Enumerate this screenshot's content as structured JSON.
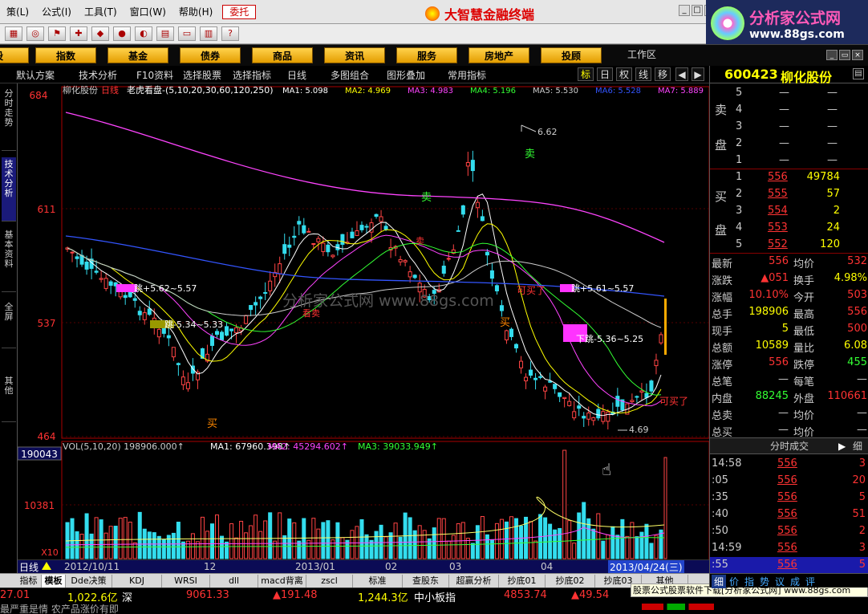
{
  "menubar": {
    "items": [
      "策(L)",
      "公式(I)",
      "工具(T)",
      "窗口(W)",
      "帮助(H)"
    ],
    "entrust": "委托",
    "app_title": "大智慧金融终端"
  },
  "brand": {
    "title": "分析家公式网",
    "url": "www.88gs.com"
  },
  "categories": [
    "股",
    "指数",
    "基金",
    "债券",
    "商品",
    "资讯",
    "服务",
    "房地产",
    "投顾"
  ],
  "workarea": "工作区",
  "chart_toolbar": {
    "items": [
      "默认方案",
      "技术分析",
      "F10资料",
      "选择股票",
      "选择指标",
      "日线",
      "多图组合",
      "图形叠加",
      "常用指标"
    ],
    "right": [
      "标",
      "日",
      "权",
      "线",
      "移"
    ]
  },
  "vtabs": [
    "分时走势",
    "技术分析",
    "基本资料",
    "全屏",
    "其他"
  ],
  "chart": {
    "stock": "柳化股份",
    "period": "日线",
    "indicator": "老虎看盘-(5,10,20,30,60,120,250)",
    "ma_legend": [
      {
        "name": "MA1: 5.098",
        "color": "#ffffff"
      },
      {
        "name": "MA2: 4.969",
        "color": "#ffff00"
      },
      {
        "name": "MA3: 4.983",
        "color": "#ff44ff"
      },
      {
        "name": "MA4: 5.196",
        "color": "#33ff33"
      },
      {
        "name": "MA5: 5.530",
        "color": "#cccccc"
      },
      {
        "name": "MA6: 5.528",
        "color": "#3355ff"
      },
      {
        "name": "MA7: 5.889",
        "color": "#ff44ff"
      }
    ],
    "price_ticks": [
      "684",
      "611",
      "537",
      "464"
    ],
    "annotations": [
      {
        "text": "6.62",
        "color": "#cccccc"
      },
      {
        "text": "卖",
        "color": "#33ff33"
      },
      {
        "text": "卖",
        "color": "#33ff33"
      },
      {
        "text": "买",
        "color": "#ff8800"
      },
      {
        "text": "买",
        "color": "#ff8800"
      },
      {
        "text": "可买了",
        "color": "#ff3333"
      },
      {
        "text": "可买了",
        "color": "#ff3333"
      },
      {
        "text": "看卖",
        "color": "#ff3333"
      },
      {
        "text": "卖",
        "color": "#ff3333"
      },
      {
        "text": "4.69",
        "color": "#cccccc"
      },
      {
        "text": "跳+5.62~5.57",
        "color": "#ffffff"
      },
      {
        "text": "跳-5.34~5.33",
        "color": "#ffffff"
      },
      {
        "text": "跳+5.61~5.57",
        "color": "#ffffff"
      },
      {
        "text": "下跳-5.36~5.25",
        "color": "#ffffff"
      }
    ],
    "watermark": "分析家公式网 www.88gs.com"
  },
  "vol": {
    "legend": "VOL(5,10,20)  198906.000↑",
    "ma1": "MA1: 67960.398↑",
    "ma2": "MA2: 45294.602↑",
    "ma3": "MA3: 39033.949↑",
    "top": "190043",
    "mid": "10381",
    "unit": "X10"
  },
  "datebar": {
    "label": "日线",
    "dates": [
      "2012/10/11",
      "12",
      "2013/01",
      "02",
      "03",
      "04",
      "2013/04/24(三)"
    ]
  },
  "bottom_tabs": [
    "指标",
    "模板",
    "Dde决策",
    "KDJ",
    "WRSI",
    "dll",
    "macd背离",
    "zscl",
    "标准",
    "查股东",
    "超赢分析",
    "抄底01",
    "抄底02",
    "抄底03",
    "其他"
  ],
  "status": {
    "s1": "27.01",
    "s2": "1,022.6亿",
    "s3": "深",
    "s4": "9061.33",
    "s5": "▲191.48",
    "s6": "1,244.3亿",
    "s7": "中小板指",
    "s8": "4853.74",
    "s9": "▲49.54",
    "ticker": "最严重是情 农产品涨价有即"
  },
  "ad": "股票公式股票软件下载[分析家公式网] www.88gs.com",
  "quote": {
    "code": "600423",
    "name": "柳化股份",
    "sell": [
      {
        "n": "5",
        "p": "—",
        "v": "—"
      },
      {
        "n": "4",
        "p": "—",
        "v": "—"
      },
      {
        "n": "3",
        "p": "—",
        "v": "—"
      },
      {
        "n": "2",
        "p": "—",
        "v": "—"
      },
      {
        "n": "1",
        "p": "—",
        "v": "—"
      }
    ],
    "buy": [
      {
        "n": "1",
        "p": "556",
        "v": "49784"
      },
      {
        "n": "2",
        "p": "555",
        "v": "57"
      },
      {
        "n": "3",
        "p": "554",
        "v": "2"
      },
      {
        "n": "4",
        "p": "553",
        "v": "24"
      },
      {
        "n": "5",
        "p": "552",
        "v": "120"
      }
    ],
    "sell_label": [
      "卖",
      "盘"
    ],
    "buy_label": [
      "买",
      "盘"
    ],
    "stats": [
      {
        "l1": "最新",
        "v1": "556",
        "c1": "#ff3333",
        "l2": "均价",
        "v2": "532",
        "c2": "#ff3333"
      },
      {
        "l1": "涨跌",
        "v1": "▲051",
        "c1": "#ff3333",
        "l2": "换手",
        "v2": "4.98%",
        "c2": "#ffff00"
      },
      {
        "l1": "涨幅",
        "v1": "10.10%",
        "c1": "#ff3333",
        "l2": "今开",
        "v2": "503",
        "c2": "#ff3333"
      },
      {
        "l1": "总手",
        "v1": "198906",
        "c1": "#ffff00",
        "l2": "最高",
        "v2": "556",
        "c2": "#ff3333"
      },
      {
        "l1": "现手",
        "v1": "5",
        "c1": "#ffff00",
        "l2": "最低",
        "v2": "500",
        "c2": "#ff3333"
      },
      {
        "l1": "总额",
        "v1": "10589",
        "c1": "#ffff00",
        "l2": "量比",
        "v2": "6.08",
        "c2": "#ffff00"
      },
      {
        "l1": "涨停",
        "v1": "556",
        "c1": "#ff3333",
        "l2": "跌停",
        "v2": "455",
        "c2": "#33ff33"
      },
      {
        "l1": "总笔",
        "v1": "—",
        "c1": "#cccccc",
        "l2": "每笔",
        "v2": "—",
        "c2": "#cccccc"
      },
      {
        "l1": "内盘",
        "v1": "88245",
        "c1": "#33ff33",
        "l2": "外盘",
        "v2": "110661",
        "c2": "#ff3333"
      },
      {
        "l1": "总卖",
        "v1": "—",
        "c1": "#cccccc",
        "l2": "均价",
        "v2": "—",
        "c2": "#cccccc"
      },
      {
        "l1": "总买",
        "v1": "—",
        "c1": "#cccccc",
        "l2": "均价",
        "v2": "—",
        "c2": "#cccccc"
      }
    ],
    "tick_title": "分时成交",
    "tick_more": "细",
    "ticks": [
      {
        "t": "14:58",
        "p": "556",
        "v": "3"
      },
      {
        "t": ":05",
        "p": "556",
        "v": "20"
      },
      {
        "t": ":35",
        "p": "556",
        "v": "5"
      },
      {
        "t": ":40",
        "p": "556",
        "v": "51"
      },
      {
        "t": ":50",
        "p": "556",
        "v": "2"
      },
      {
        "t": "14:59",
        "p": "556",
        "v": "3"
      },
      {
        "t": ":55",
        "p": "556",
        "v": "5"
      }
    ],
    "tabs": [
      "细",
      "价",
      "指",
      "势",
      "议",
      "成",
      "评"
    ]
  }
}
